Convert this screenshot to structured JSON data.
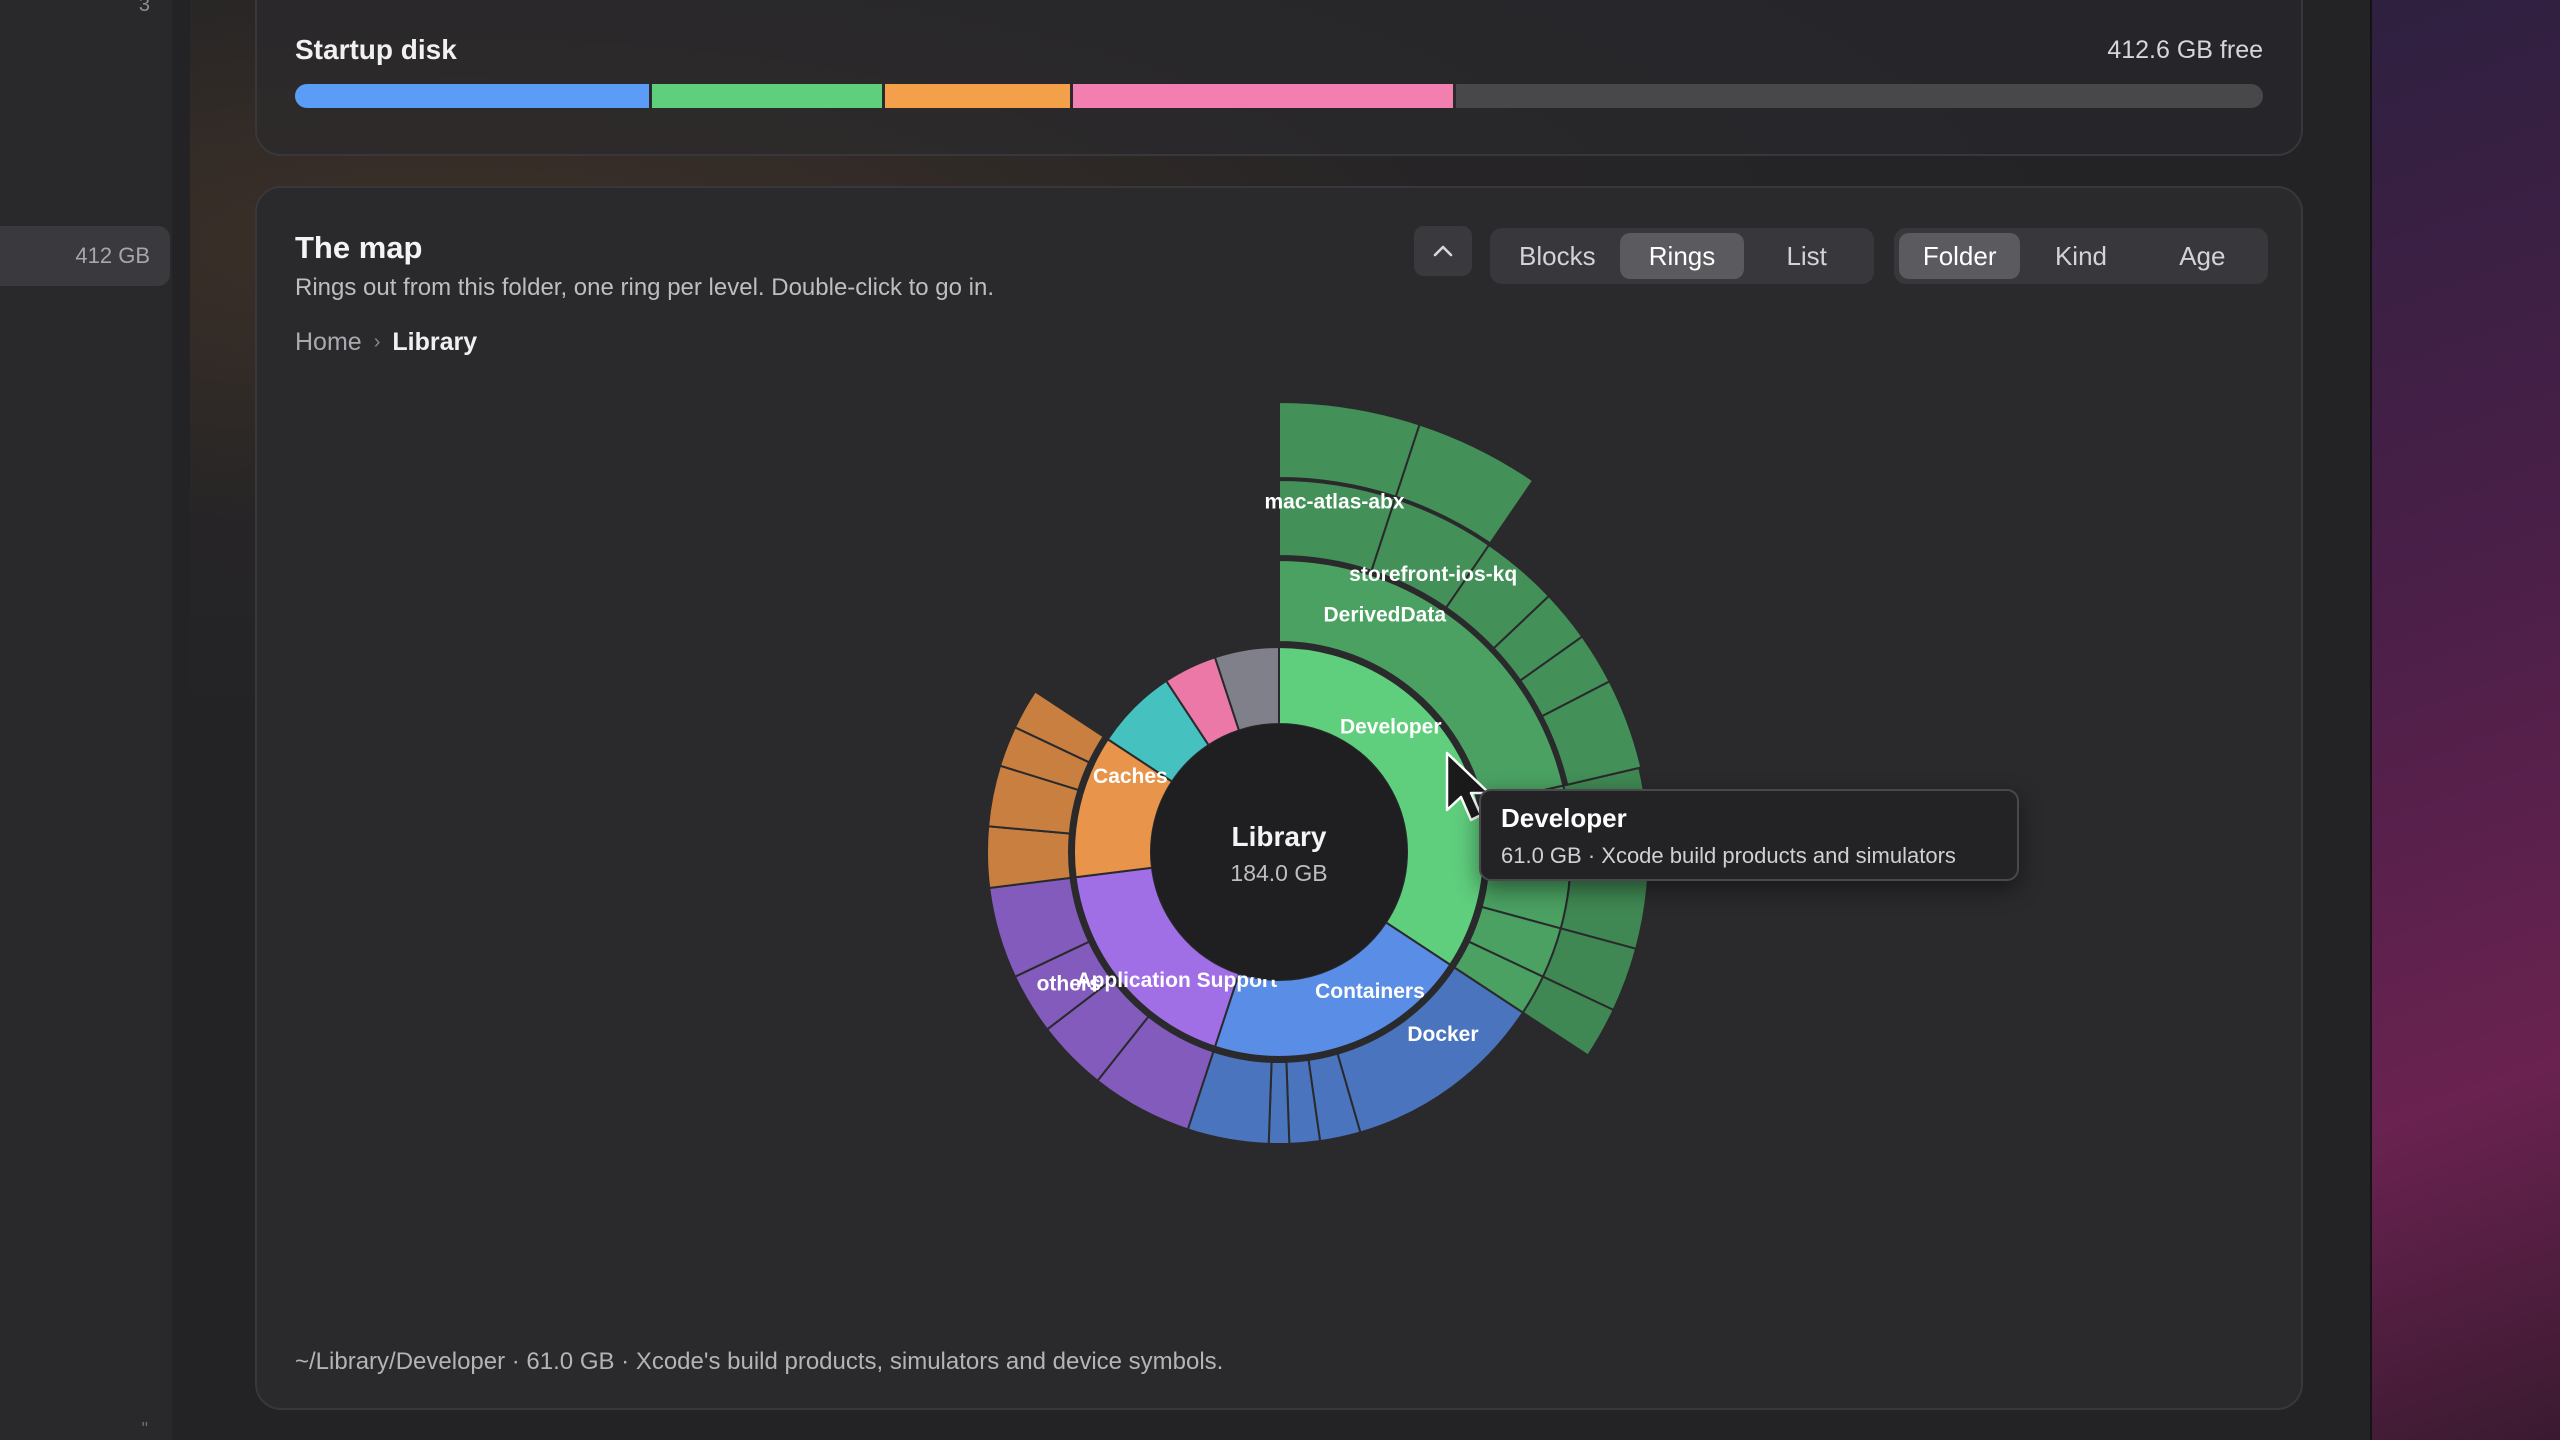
{
  "sidebar": {
    "top_number": "3",
    "selected_row_value": "412 GB",
    "bottom_glyph": "\""
  },
  "startup_disk": {
    "title": "Startup disk",
    "free_label": "412.6 GB free",
    "segments": [
      {
        "color": "#5a9cf6",
        "fraction": 0.18
      },
      {
        "color": "#5fce7d",
        "fraction": 0.117
      },
      {
        "color": "#f4a04b",
        "fraction": 0.094
      },
      {
        "color": "#f27fb0",
        "fraction": 0.193
      }
    ],
    "remaining_color": "#48484b"
  },
  "map": {
    "title": "The map",
    "subtitle": "Rings out from this folder, one ring per level. Double-click to go in.",
    "breadcrumb": {
      "items": [
        "Home",
        "Library"
      ]
    },
    "collapse_icon": "chevron-up-icon",
    "view_modes": [
      {
        "label": "Blocks",
        "active": false
      },
      {
        "label": "Rings",
        "active": true
      },
      {
        "label": "List",
        "active": false
      }
    ],
    "color_modes": [
      {
        "label": "Folder",
        "active": true
      },
      {
        "label": "Kind",
        "active": false
      },
      {
        "label": "Age",
        "active": false
      }
    ],
    "center": {
      "name": "Library",
      "size": "184.0 GB"
    },
    "tooltip": {
      "title": "Developer",
      "detail": "61.0 GB · Xcode build products and simulators"
    },
    "footer": "~/Library/Developer · 61.0 GB · Xcode's build products, simulators and device symbols."
  },
  "chart_data": {
    "type": "sunburst",
    "root": {
      "name": "Library",
      "size_gb": 184.0
    },
    "inner_ring": [
      {
        "name": "Developer",
        "value": 61.0,
        "color": "#5fce7d",
        "label": "Developer"
      },
      {
        "name": "Containers",
        "value": 37.0,
        "color": "#5a8ee6",
        "label": "Containers"
      },
      {
        "name": "Application Support",
        "value": 32.0,
        "color": "#a06fe6",
        "label": "Application Support"
      },
      {
        "name": "Caches",
        "value": 20.0,
        "color": "#e8944a",
        "label": "Caches"
      },
      {
        "name": "(teal)",
        "value": 11.5,
        "color": "#45c2c0",
        "label": ""
      },
      {
        "name": "(pink)",
        "value": 7.5,
        "color": "#ec78a8",
        "label": ""
      },
      {
        "name": "(gray)",
        "value": 9.0,
        "color": "#80808a",
        "label": ""
      }
    ],
    "developer_children": [
      {
        "name": "DerivedData",
        "value": 38,
        "label": "DerivedData"
      },
      {
        "name": "(other)",
        "value": 8,
        "label": ""
      },
      {
        "name": "(other)",
        "value": 6,
        "label": ""
      },
      {
        "name": "(other)",
        "value": 5,
        "label": ""
      },
      {
        "name": "(other)",
        "value": 4,
        "label": ""
      }
    ],
    "deriveddata_children": [
      {
        "name": "mac-atlas-abx",
        "value": 9,
        "label": "mac-atlas-abx"
      },
      {
        "name": "storefront-ios-kq",
        "value": 8,
        "label": "storefront-ios-kq"
      },
      {
        "name": "(other)",
        "value": 6,
        "label": ""
      },
      {
        "name": "(other)",
        "value": 4,
        "label": ""
      },
      {
        "name": "(other)",
        "value": 4,
        "label": ""
      },
      {
        "name": "(other)",
        "value": 7,
        "label": ""
      }
    ],
    "containers_children": [
      {
        "name": "Docker",
        "value": 20,
        "label": "Docker"
      },
      {
        "name": "(other)",
        "value": 4,
        "label": ""
      },
      {
        "name": "(other)",
        "value": 3,
        "label": ""
      },
      {
        "name": "(other)",
        "value": 2,
        "label": ""
      },
      {
        "name": "(other)",
        "value": 8,
        "label": ""
      }
    ],
    "appsupport_children": [
      {
        "name": "(other)",
        "value": 10,
        "label": ""
      },
      {
        "name": "(other)",
        "value": 7,
        "label": ""
      },
      {
        "name": "(other)",
        "value": 6,
        "label": ""
      },
      {
        "name": "others",
        "value": 9,
        "label": "others"
      }
    ],
    "caches_children": [
      {
        "name": "(other)",
        "value": 6,
        "label": ""
      },
      {
        "name": "(other)",
        "value": 6,
        "label": ""
      },
      {
        "name": "(other)",
        "value": 4,
        "label": ""
      },
      {
        "name": "(other)",
        "value": 4,
        "label": ""
      }
    ]
  }
}
